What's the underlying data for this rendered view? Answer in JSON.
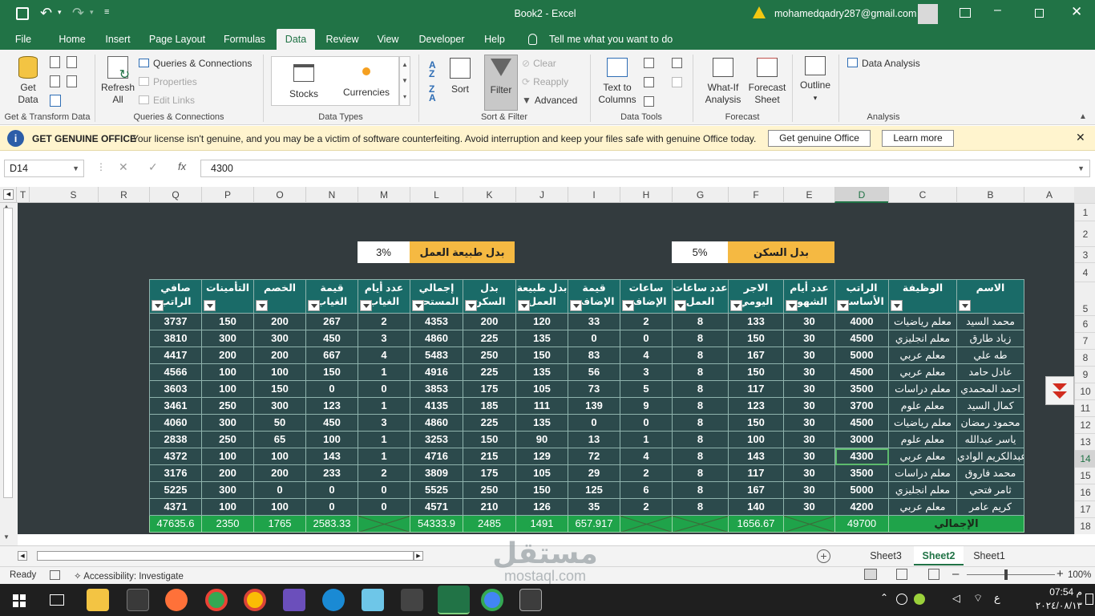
{
  "window": {
    "doc_title": "Book2  -  Excel",
    "account": "mohamedqadry287@gmail.com"
  },
  "tabs": [
    "File",
    "Home",
    "Insert",
    "Page Layout",
    "Formulas",
    "Data",
    "Review",
    "View",
    "Developer",
    "Help"
  ],
  "tell_me": "Tell me what you want to do",
  "ribbon": {
    "get_data": "Get Data",
    "queries_connections": "Queries & Connections",
    "properties": "Properties",
    "edit_links": "Edit Links",
    "refresh_all": "Refresh All",
    "stocks": "Stocks",
    "currencies": "Currencies",
    "sort": "Sort",
    "filter": "Filter",
    "clear": "Clear",
    "reapply": "Reapply",
    "advanced": "Advanced",
    "text_to_columns": "Text to Columns",
    "what_if": "What-If Analysis",
    "forecast_sheet": "Forecast Sheet",
    "outline": "Outline",
    "data_analysis": "Data Analysis",
    "groups": [
      "Get & Transform Data",
      "Queries & Connections",
      "Data Types",
      "Sort & Filter",
      "Data Tools",
      "Forecast",
      "Analysis"
    ]
  },
  "message": {
    "title": "GET GENUINE OFFICE",
    "text": "Your license isn't genuine, and you may be a victim of software counterfeiting. Avoid interruption and keep your files safe with genuine Office today.",
    "btn_genuine": "Get genuine Office",
    "btn_learn": "Learn more"
  },
  "formula_bar": {
    "name_box": "D14",
    "value": "4300"
  },
  "columns": [
    "T",
    "S",
    "R",
    "Q",
    "P",
    "O",
    "N",
    "M",
    "L",
    "K",
    "J",
    "I",
    "H",
    "G",
    "F",
    "E",
    "D",
    "C",
    "B",
    "A"
  ],
  "rows": [
    "1",
    "2",
    "3",
    "4",
    "5",
    "6",
    "7",
    "8",
    "9",
    "10",
    "11",
    "12",
    "13",
    "14",
    "15",
    "16",
    "17",
    "18"
  ],
  "labels": {
    "housing_label": "بدل السكن",
    "housing_value": "5%",
    "nature_label": "بدل طبيعة العمل",
    "nature_value": "3%"
  },
  "table": {
    "headers": [
      "صافي الراتب",
      "التأمينات",
      "الخصم",
      "قيمة الغياب",
      "عدد أيام الغياب",
      "إجمالي المستحق",
      "بدل السكن",
      "بدل طبيعة العمل",
      "قيمة الإضافي",
      "ساعات الإضافي",
      "عدد ساعات العمل",
      "الاجر اليومي",
      "عدد أيام الشهور",
      "الراتب الأساسي",
      "الوظيفة",
      "الاسم"
    ],
    "rows": [
      [
        "3737",
        "150",
        "200",
        "267",
        "2",
        "4353",
        "200",
        "120",
        "33",
        "2",
        "8",
        "133",
        "30",
        "4000",
        "معلم رياضيات",
        "محمد السيد"
      ],
      [
        "3810",
        "300",
        "300",
        "450",
        "3",
        "4860",
        "225",
        "135",
        "0",
        "0",
        "8",
        "150",
        "30",
        "4500",
        "معلم انجليزي",
        "زياد طارق"
      ],
      [
        "4417",
        "200",
        "200",
        "667",
        "4",
        "5483",
        "250",
        "150",
        "83",
        "4",
        "8",
        "167",
        "30",
        "5000",
        "معلم عربي",
        "طه علي"
      ],
      [
        "4566",
        "100",
        "100",
        "150",
        "1",
        "4916",
        "225",
        "135",
        "56",
        "3",
        "8",
        "150",
        "30",
        "4500",
        "معلم عربي",
        "عادل حامد"
      ],
      [
        "3603",
        "100",
        "150",
        "0",
        "0",
        "3853",
        "175",
        "105",
        "73",
        "5",
        "8",
        "117",
        "30",
        "3500",
        "معلم دراسات",
        "احمد المحمدي"
      ],
      [
        "3461",
        "250",
        "300",
        "123",
        "1",
        "4135",
        "185",
        "111",
        "139",
        "9",
        "8",
        "123",
        "30",
        "3700",
        "معلم علوم",
        "كمال السيد"
      ],
      [
        "4060",
        "300",
        "50",
        "450",
        "3",
        "4860",
        "225",
        "135",
        "0",
        "0",
        "8",
        "150",
        "30",
        "4500",
        "معلم رياضيات",
        "محمود رمضان"
      ],
      [
        "2838",
        "250",
        "65",
        "100",
        "1",
        "3253",
        "150",
        "90",
        "13",
        "1",
        "8",
        "100",
        "30",
        "3000",
        "معلم علوم",
        "ياسر عبدالله"
      ],
      [
        "4372",
        "100",
        "100",
        "143",
        "1",
        "4716",
        "215",
        "129",
        "72",
        "4",
        "8",
        "143",
        "30",
        "4300",
        "معلم عربي",
        "عبدالكريم الوادي"
      ],
      [
        "3176",
        "200",
        "200",
        "233",
        "2",
        "3809",
        "175",
        "105",
        "29",
        "2",
        "8",
        "117",
        "30",
        "3500",
        "معلم دراسات",
        "محمد فاروق"
      ],
      [
        "5225",
        "300",
        "0",
        "0",
        "0",
        "5525",
        "250",
        "150",
        "125",
        "6",
        "8",
        "167",
        "30",
        "5000",
        "معلم انجليزي",
        "ثامر فتحي"
      ],
      [
        "4371",
        "100",
        "100",
        "0",
        "0",
        "4571",
        "210",
        "126",
        "35",
        "2",
        "8",
        "140",
        "30",
        "4200",
        "معلم عربي",
        "كريم عامر"
      ]
    ],
    "totals": [
      "47635.6",
      "2350",
      "1765",
      "2583.33",
      "",
      "54333.9",
      "2485",
      "1491",
      "657.917",
      "",
      "",
      "1656.67",
      "",
      "49700"
    ],
    "total_label": "الإجمالي"
  },
  "sheets": [
    "Sheet3",
    "Sheet2",
    "Sheet1"
  ],
  "status": {
    "ready": "Ready",
    "accessibility": "Accessibility: Investigate",
    "zoom": "100%"
  },
  "clock": {
    "time": "07:54 م",
    "date": "٢٠٢٤/٠٨/١٣"
  },
  "watermark": {
    "ar": "مستقل",
    "en": "mostaql.com"
  }
}
